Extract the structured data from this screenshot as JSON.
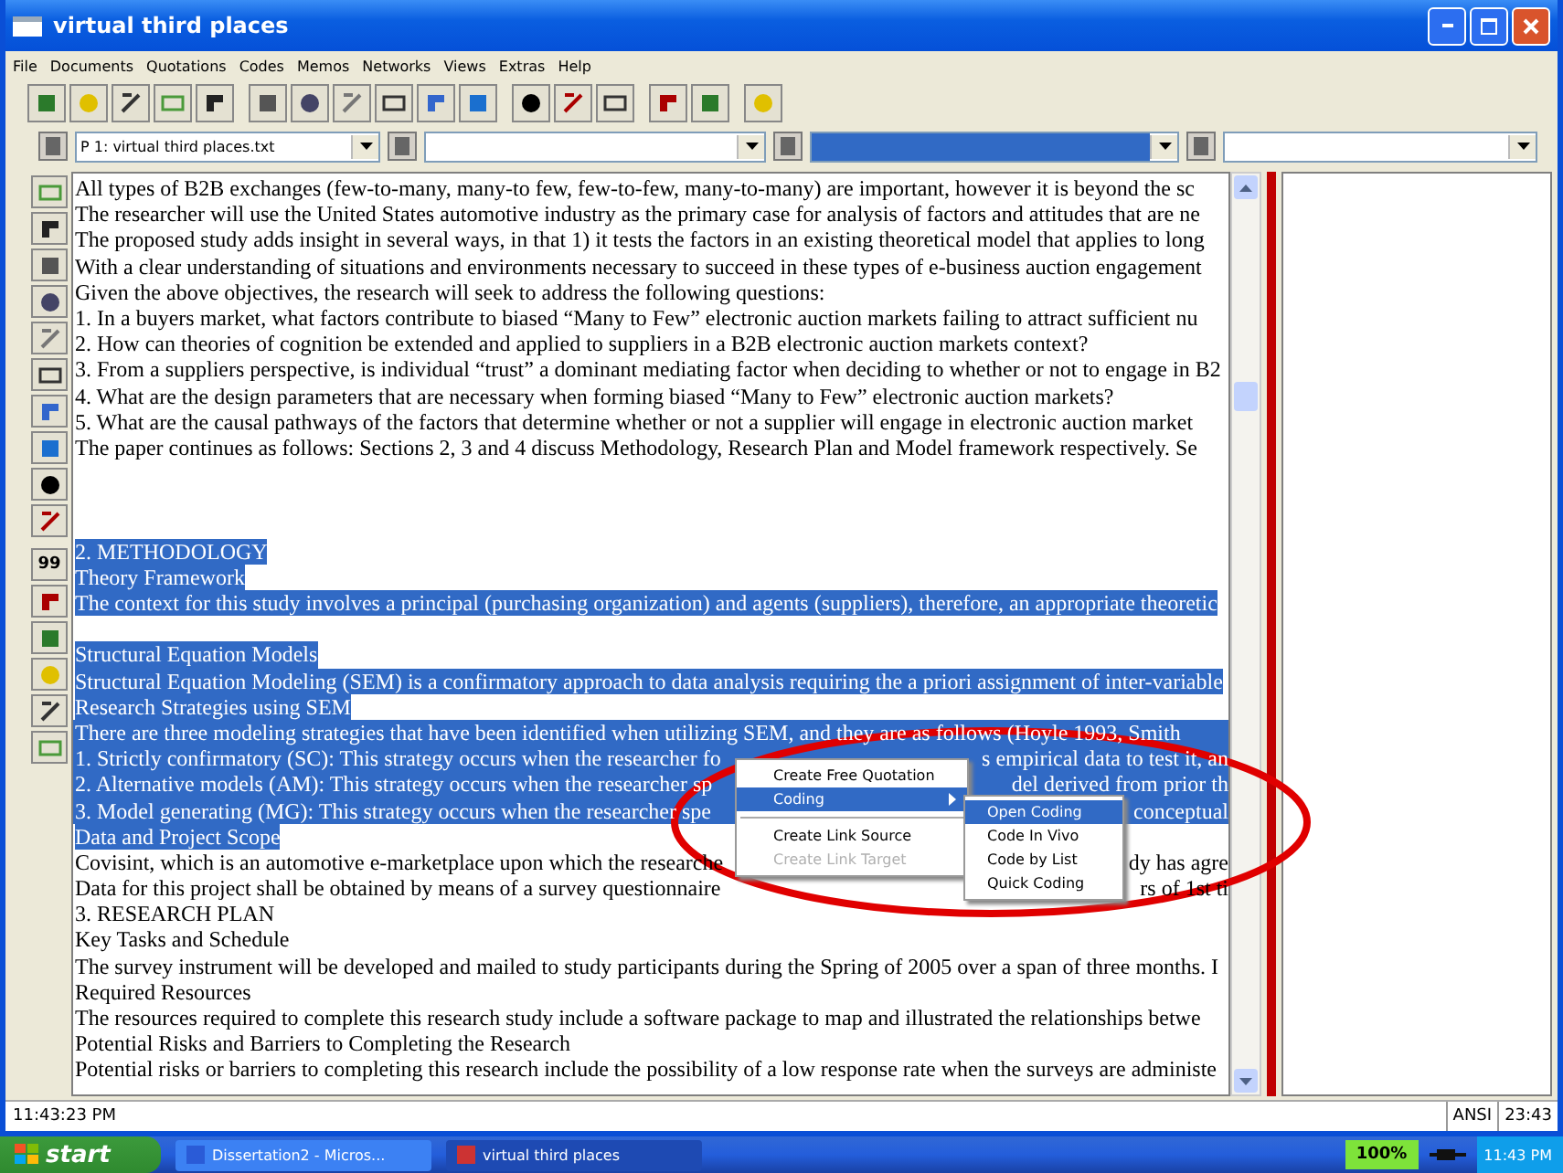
{
  "window": {
    "title": "virtual third places"
  },
  "menu": [
    "File",
    "Documents",
    "Quotations",
    "Codes",
    "Memos",
    "Networks",
    "Views",
    "Extras",
    "Help"
  ],
  "side_label": "99",
  "selectors": [
    {
      "value": "P 1: virtual third places.txt",
      "focused": false
    },
    {
      "focused": false
    },
    {
      "focused": true
    },
    {
      "focused": false
    }
  ],
  "document": {
    "lines": [
      {
        "text": "All types of B2B exchanges (few-to-many, many-to few, few-to-few, many-to-many) are important, however it is beyond the sc",
        "selected": false
      },
      {
        "text": "The researcher will use the United States automotive industry as the primary case for analysis of factors and attitudes that are ne",
        "selected": false
      },
      {
        "text": "The proposed study adds insight in several ways,  in that  1) it tests the factors in an existing theoretical model that applies to long",
        "selected": false
      },
      {
        "text": "With a clear understanding of situations and environments necessary to succeed in these types of e-business auction engagement",
        "selected": false
      },
      {
        "text": "Given the above objectives, the research will seek to address the following questions:",
        "selected": false
      },
      {
        "text": "1.  In a buyers market, what factors contribute to biased “Many to Few” electronic auction markets failing to attract sufficient nu",
        "selected": false
      },
      {
        "text": "2.  How can theories of cognition be extended and applied to suppliers in a B2B electronic auction markets context?",
        "selected": false
      },
      {
        "text": "3.  From a suppliers perspective, is individual “trust” a dominant mediating factor when deciding to whether or not to engage in B2",
        "selected": false
      },
      {
        "text": "4.  What are the design parameters that are necessary when forming biased “Many to Few” electronic auction markets?",
        "selected": false
      },
      {
        "text": "5.  What are the causal pathways of the factors that determine whether or not a supplier will engage in electronic auction market",
        "selected": false
      },
      {
        "text": "The paper continues as follows: Sections 2, 3 and 4 discuss Methodology, Research Plan and Model framework respectively.  Se",
        "selected": false
      },
      {
        "kind": "blank"
      },
      {
        "kind": "blank"
      },
      {
        "kind": "blank"
      },
      {
        "text": "2.  METHODOLOGY",
        "selected": true
      },
      {
        "text": "Theory Framework",
        "selected": true
      },
      {
        "text": "The context for this study involves a principal (purchasing organization) and agents (suppliers), therefore, an appropriate theoretic",
        "selected": true
      },
      {
        "kind": "blank",
        "selected": false
      },
      {
        "text": "Structural Equation Models",
        "selected": true
      },
      {
        "text": "Structural Equation Modeling (SEM) is a confirmatory approach to data analysis requiring the a priori assignment of inter-variable",
        "selected": true
      },
      {
        "text": "Research Strategies using SEM",
        "selected": true
      },
      {
        "text": "There are three modeling strategies that have been identified when utilizing SEM, and they are as follows (Hoyle 1993, Smith",
        "selected": true
      },
      {
        "text": "1.  Strictly confirmatory (SC): This strategy occurs when the researcher fo",
        "after": "s empirical data to test it, an",
        "selected": true
      },
      {
        "text": "2.  Alternative models (AM): This strategy occurs when the researcher sp",
        "after": "del derived from prior th",
        "selected": true
      },
      {
        "text": "3.  Model generating (MG): This strategy occurs when the researcher spe",
        "after": "conceptual",
        "selected": true
      },
      {
        "text": "Data and Project Scope",
        "selected": true
      },
      {
        "text": "Covisint, which is an automotive e-marketplace upon which the researche",
        "after": "dy has agre",
        "selected": false
      },
      {
        "text": "Data for this project shall be obtained by means of a survey questionnaire",
        "after": "rs of 1st ti",
        "selected": false
      },
      {
        "text": "3.  RESEARCH PLAN",
        "selected": false
      },
      {
        "text": "Key Tasks and Schedule",
        "selected": false
      },
      {
        "text": "The survey instrument will be developed and mailed to study participants during the Spring of 2005 over a span of three months. I",
        "selected": false
      },
      {
        "text": "Required Resources",
        "selected": false
      },
      {
        "text": "The resources required to complete this research study include a software package to map and illustrated the relationships betwe",
        "selected": false
      },
      {
        "text": "Potential Risks and Barriers to Completing the Research",
        "selected": false
      },
      {
        "text": "Potential risks or barriers to completing this research include the possibility of a low response rate when the surveys are administe",
        "selected": false
      }
    ]
  },
  "context_menu": {
    "items": [
      {
        "label": "Create Free Quotation",
        "selected": false,
        "disabled": false,
        "submenu": false,
        "separator_before": false
      },
      {
        "label": "Coding",
        "selected": true,
        "disabled": false,
        "submenu": true,
        "separator_before": false
      },
      {
        "label": "Create Link Source",
        "selected": false,
        "disabled": false,
        "submenu": false,
        "separator_before": true
      },
      {
        "label": "Create Link Target",
        "selected": false,
        "disabled": true,
        "submenu": false,
        "separator_before": false
      }
    ],
    "submenu": [
      {
        "label": "Open Coding",
        "selected": true
      },
      {
        "label": "Code In Vivo",
        "selected": false
      },
      {
        "label": "Code by List",
        "selected": false
      },
      {
        "label": "Quick Coding",
        "selected": false
      }
    ]
  },
  "status_bar": {
    "time": "11:43:23 PM",
    "encoding": "ANSI",
    "clock": "23:43"
  },
  "taskbar": {
    "start": "start",
    "tasks": [
      {
        "label": "Dissertation2 - Micros...",
        "selected": false
      },
      {
        "label": "virtual third places",
        "selected": true
      }
    ],
    "battery": "100%",
    "clock": "11:43 PM"
  }
}
